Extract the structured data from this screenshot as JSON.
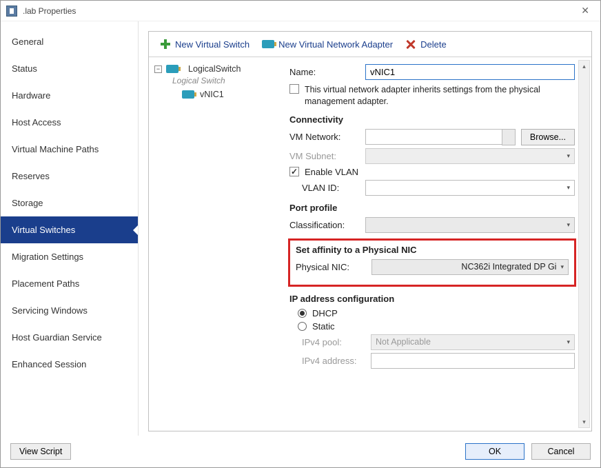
{
  "window": {
    "title": ".lab Properties"
  },
  "nav": {
    "items": [
      {
        "label": "General"
      },
      {
        "label": "Status"
      },
      {
        "label": "Hardware"
      },
      {
        "label": "Host Access"
      },
      {
        "label": "Virtual Machine Paths"
      },
      {
        "label": "Reserves"
      },
      {
        "label": "Storage"
      },
      {
        "label": "Virtual Switches",
        "selected": true
      },
      {
        "label": "Migration Settings"
      },
      {
        "label": "Placement Paths"
      },
      {
        "label": "Servicing Windows"
      },
      {
        "label": "Host Guardian Service"
      },
      {
        "label": "Enhanced Session"
      }
    ]
  },
  "toolbar": {
    "new_switch": "New Virtual Switch",
    "new_adapter": "New Virtual Network Adapter",
    "delete": "Delete"
  },
  "tree": {
    "switch_name": "LogicalSwitch",
    "switch_sub": "Logical Switch",
    "adapter_name": "vNIC1"
  },
  "form": {
    "name_label": "Name:",
    "name_value": "vNIC1",
    "inherit_text": "This virtual network adapter inherits settings from the physical management adapter.",
    "connectivity_h": "Connectivity",
    "vm_network_label": "VM Network:",
    "vm_network_value": "",
    "browse_btn": "Browse...",
    "vm_subnet_label": "VM Subnet:",
    "enable_vlan_label": "Enable VLAN",
    "vlan_id_label": "VLAN ID:",
    "vlan_id_value": "",
    "port_profile_h": "Port profile",
    "classification_label": "Classification:",
    "classification_value": "",
    "affinity_h": "Set affinity to a Physical NIC",
    "physical_nic_label": "Physical NIC:",
    "physical_nic_value": "NC362i Integrated DP Gi",
    "ip_config_h": "IP address configuration",
    "dhcp_label": "DHCP",
    "static_label": "Static",
    "ipv4_pool_label": "IPv4 pool:",
    "ipv4_pool_value": "Not Applicable",
    "ipv4_addr_label": "IPv4 address:",
    "ipv4_addr_value": ""
  },
  "footer": {
    "view_script": "View Script",
    "ok": "OK",
    "cancel": "Cancel"
  }
}
